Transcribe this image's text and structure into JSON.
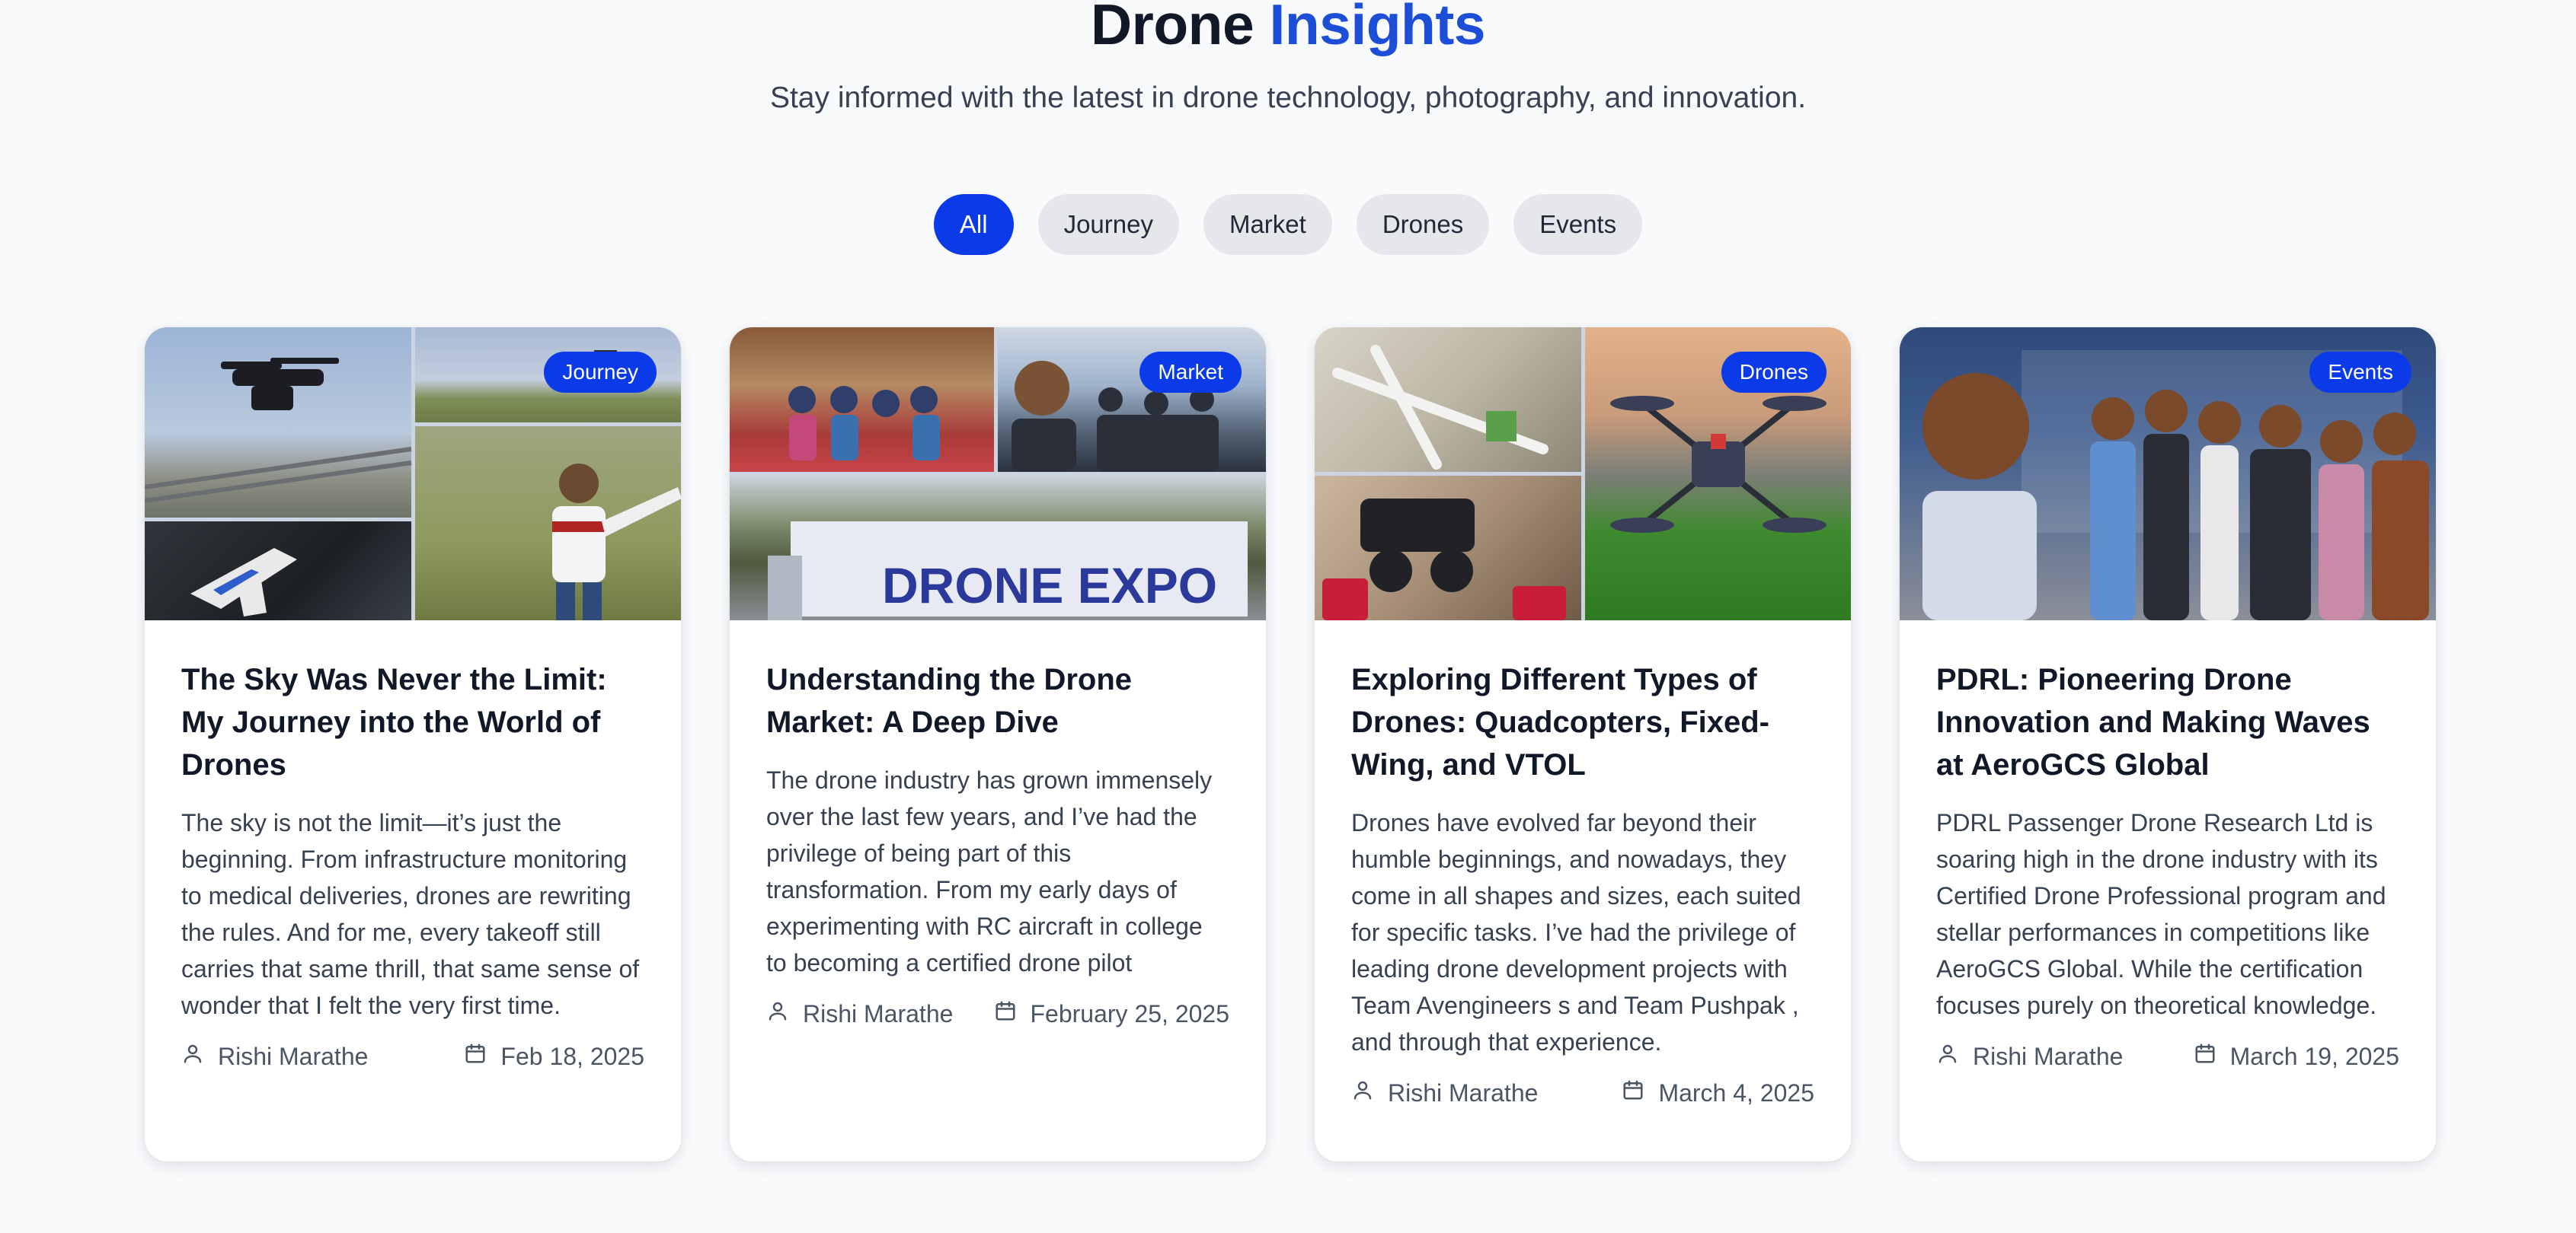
{
  "header": {
    "title_main": "Drone",
    "title_accent": "Insights",
    "subtitle": "Stay informed with the latest in drone technology, photography, and innovation."
  },
  "filters": [
    {
      "label": "All",
      "active": true
    },
    {
      "label": "Journey",
      "active": false
    },
    {
      "label": "Market",
      "active": false
    },
    {
      "label": "Drones",
      "active": false
    },
    {
      "label": "Events",
      "active": false
    }
  ],
  "colors": {
    "accent": "#0b3be8",
    "heading_accent": "#1d4ed8",
    "pill_bg": "#e5e7eb",
    "page_bg": "#f8fafc"
  },
  "icons": {
    "author": "user-icon",
    "date": "calendar-icon"
  },
  "posts": [
    {
      "category": "Journey",
      "title": "The Sky Was Never the Limit: My Journey into the World of Drones",
      "excerpt": "The sky is not the limit—it’s just the beginning. From infrastructure monitoring to medical deliveries, drones are rewriting the rules. And for me, every takeoff still carries that same thrill, that same sense of wonder that I felt the very first time.",
      "author": "Rishi Marathe",
      "date": "Feb 18, 2025"
    },
    {
      "category": "Market",
      "title": "Understanding the Drone Market: A Deep Dive",
      "excerpt": "The drone industry has grown immensely over the last few years, and I’ve had the privilege of being part of this transformation. From my early days of experimenting with RC aircraft in college to becoming a certified drone pilot",
      "author": "Rishi Marathe",
      "date": "February 25, 2025",
      "image_text": "DRONE EXPO"
    },
    {
      "category": "Drones",
      "title": "Exploring Different Types of Drones: Quadcopters, Fixed-Wing, and VTOL",
      "excerpt": "Drones have evolved far beyond their humble beginnings, and nowadays, they come in all shapes and sizes, each suited for specific tasks. I’ve had the privilege of leading drone development projects with Team Avengineers s and Team Pushpak , and through that experience.",
      "author": "Rishi Marathe",
      "date": "March 4, 2025"
    },
    {
      "category": "Events",
      "title": "PDRL: Pioneering Drone Innovation and Making Waves at AeroGCS Global",
      "excerpt": "PDRL Passenger Drone Research Ltd is soaring high in the drone industry with its Certified Drone Professional program and stellar performances in competitions like AeroGCS Global. While the certification focuses purely on theoretical knowledge.",
      "author": "Rishi Marathe",
      "date": "March 19, 2025"
    }
  ]
}
